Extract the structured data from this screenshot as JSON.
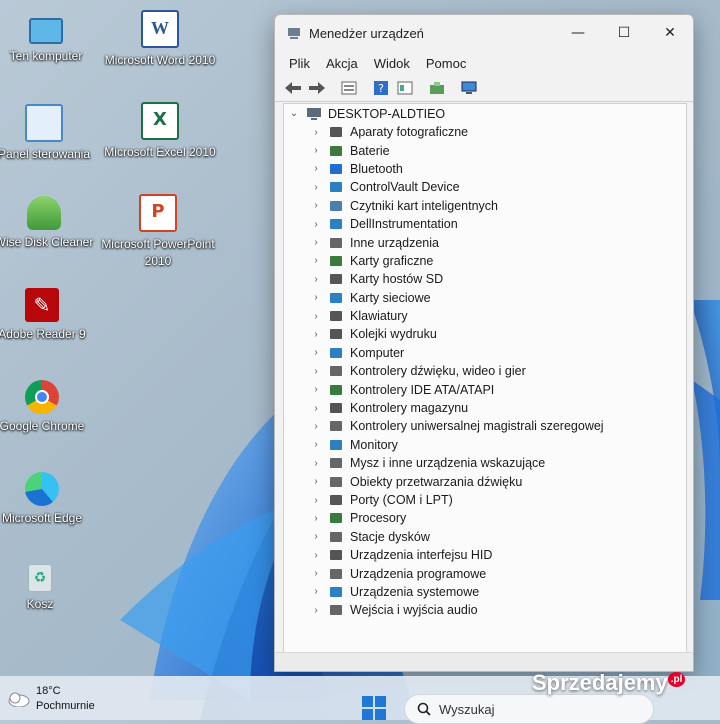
{
  "desktop": {
    "icons": [
      {
        "label": "Ten komputer",
        "icon": "monitor-icon"
      },
      {
        "label": "Microsoft Word 2010",
        "icon": "word-icon"
      },
      {
        "label": "Panel sterowania",
        "icon": "control-panel-icon"
      },
      {
        "label": "Microsoft Excel 2010",
        "icon": "excel-icon"
      },
      {
        "label": "Wise Disk Cleaner",
        "icon": "disk-cleaner-icon"
      },
      {
        "label": "Microsoft PowerPoint 2010",
        "icon": "powerpoint-icon"
      },
      {
        "label": "Adobe Reader 9",
        "icon": "adobe-reader-icon"
      },
      {
        "label": "Google Chrome",
        "icon": "chrome-icon"
      },
      {
        "label": "Microsoft Edge",
        "icon": "edge-icon"
      },
      {
        "label": "Kosz",
        "icon": "recycle-bin-icon"
      }
    ]
  },
  "window": {
    "title": "Menedżer urządzeń",
    "controls": {
      "minimize": "—",
      "maximize": "☐",
      "close": "✕"
    },
    "menu": [
      "Plik",
      "Akcja",
      "Widok",
      "Pomoc"
    ],
    "tree": {
      "root": "DESKTOP-ALDTIEO",
      "items": [
        "Aparaty fotograficzne",
        "Baterie",
        "Bluetooth",
        "ControlVault Device",
        "Czytniki kart inteligentnych",
        "DellInstrumentation",
        "Inne urządzenia",
        "Karty graficzne",
        "Karty hostów SD",
        "Karty sieciowe",
        "Klawiatury",
        "Kolejki wydruku",
        "Komputer",
        "Kontrolery dźwięku, wideo i gier",
        "Kontrolery IDE ATA/ATAPI",
        "Kontrolery magazynu",
        "Kontrolery uniwersalnej magistrali szeregowej",
        "Monitory",
        "Mysz i inne urządzenia wskazujące",
        "Obiekty przetwarzania dźwięku",
        "Porty (COM i LPT)",
        "Procesory",
        "Stacje dysków",
        "Urządzenia interfejsu HID",
        "Urządzenia programowe",
        "Urządzenia systemowe",
        "Wejścia i wyjścia audio"
      ]
    }
  },
  "taskbar": {
    "temperature": "18°C",
    "weather": "Pochmurnie",
    "search_placeholder": "Wyszukaj"
  },
  "watermark": {
    "text": "Sprzedajemy",
    "suffix": ".pl"
  }
}
